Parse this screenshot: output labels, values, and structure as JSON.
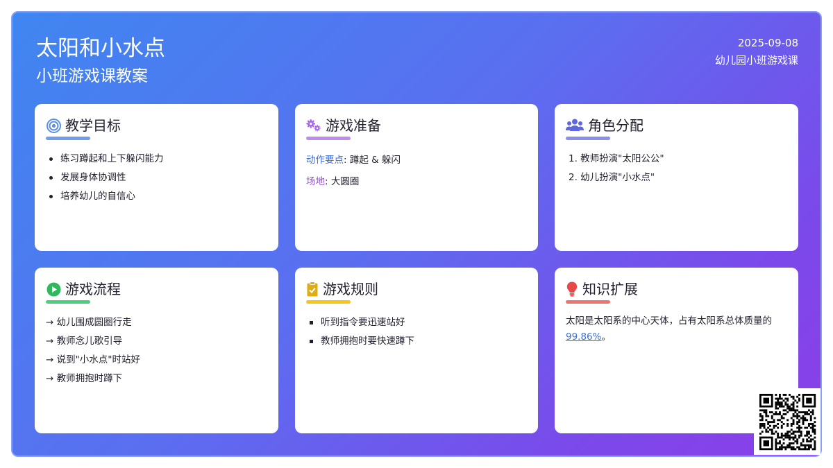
{
  "header": {
    "title": "太阳和小水点",
    "subtitle": "小班游戏课教案",
    "date": "2025-09-08",
    "meta": "幼儿园小班游戏课"
  },
  "colors": {
    "gradient_start": "#3f86f0",
    "gradient_end": "#8c3ee8",
    "goals": "#5b8fe6",
    "prep": "#b07be8",
    "roles": "#7b82e8",
    "process": "#3fc870",
    "rules": "#f2c318",
    "knowledge": "#ee6f6f"
  },
  "cards": {
    "goals": {
      "icon": "target-icon",
      "title": "教学目标",
      "items": [
        "练习蹲起和上下躲闪能力",
        "发展身体协调性",
        "培养幼儿的自信心"
      ]
    },
    "prep": {
      "icon": "gears-icon",
      "title": "游戏准备",
      "rows": [
        {
          "key": "动作要点",
          "value": ": 蹲起 & 躲闪"
        },
        {
          "key": "场地",
          "value": ": 大圆圈"
        }
      ]
    },
    "roles": {
      "icon": "users-icon",
      "title": "角色分配",
      "items": [
        "1. 教师扮演\"太阳公公\"",
        "2. 幼儿扮演\"小水点\""
      ]
    },
    "process": {
      "icon": "play-circle-icon",
      "title": "游戏流程",
      "items": [
        "→ 幼儿围成圆圈行走",
        "→ 教师念儿歌引导",
        "→ 说到\"小水点\"时站好",
        "→ 教师拥抱时蹲下"
      ]
    },
    "rules": {
      "icon": "clipboard-check-icon",
      "title": "游戏规则",
      "items": [
        "听到指令要迅速站好",
        "教师拥抱时要快速蹲下"
      ]
    },
    "knowledge": {
      "icon": "lightbulb-icon",
      "title": "知识扩展",
      "text": "太阳是太阳系的中心天体，占有太阳系总体质量的",
      "highlight": "99.86%",
      "suffix": "。"
    }
  }
}
